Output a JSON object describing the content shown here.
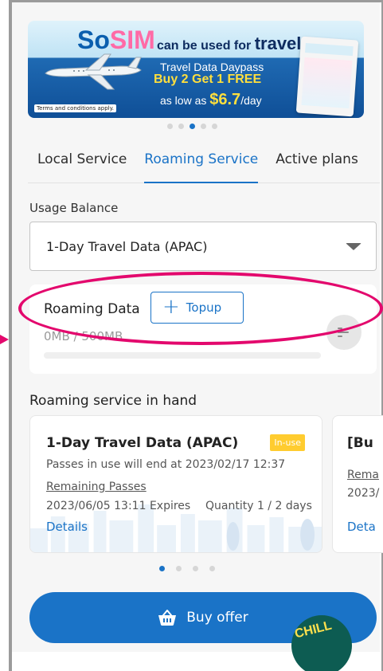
{
  "banner": {
    "brand_so": "So",
    "brand_sim": "SIM",
    "headline_lead": "can be used for ",
    "headline_word": "travel",
    "line1": "Travel Data Daypass",
    "line2": "Buy 2 Get 1 FREE",
    "line3_lead": "as low as ",
    "line3_price": "$6.7",
    "line3_unit": "/day",
    "terms": "Terms and conditions apply.",
    "dots": 5,
    "active_dot": 2
  },
  "tabs": [
    {
      "label": "Local Service",
      "active": false
    },
    {
      "label": "Roaming Service",
      "active": true
    },
    {
      "label": "Active plans",
      "active": false
    }
  ],
  "usage": {
    "label": "Usage Balance",
    "selected": "1-Day Travel Data (APAC)"
  },
  "roaming_data": {
    "title": "Roaming Data",
    "topup_label": "Topup",
    "amount": "0MB / 500MB",
    "used_fraction": 0
  },
  "in_hand": {
    "label": "Roaming service in hand",
    "cards": [
      {
        "title": "1-Day Travel Data (APAC)",
        "badge": "In-use",
        "ends": "Passes in use will end at 2023/02/17 12:37",
        "remaining_label": "Remaining Passes",
        "expires": "2023/06/05 13:11 Expires",
        "quantity": "Quantity 1 / 2 days",
        "details": "Details"
      },
      {
        "title": "[Bu",
        "remaining_label": "Rema",
        "expires": "2023/",
        "details": "Deta"
      }
    ],
    "dots": 4,
    "active_dot": 0
  },
  "buy": {
    "label": "Buy offer"
  },
  "chill_label": "CHILL",
  "colors": {
    "accent": "#1a73c7",
    "highlight": "#e3086d",
    "badge": "#ffcc2f"
  }
}
